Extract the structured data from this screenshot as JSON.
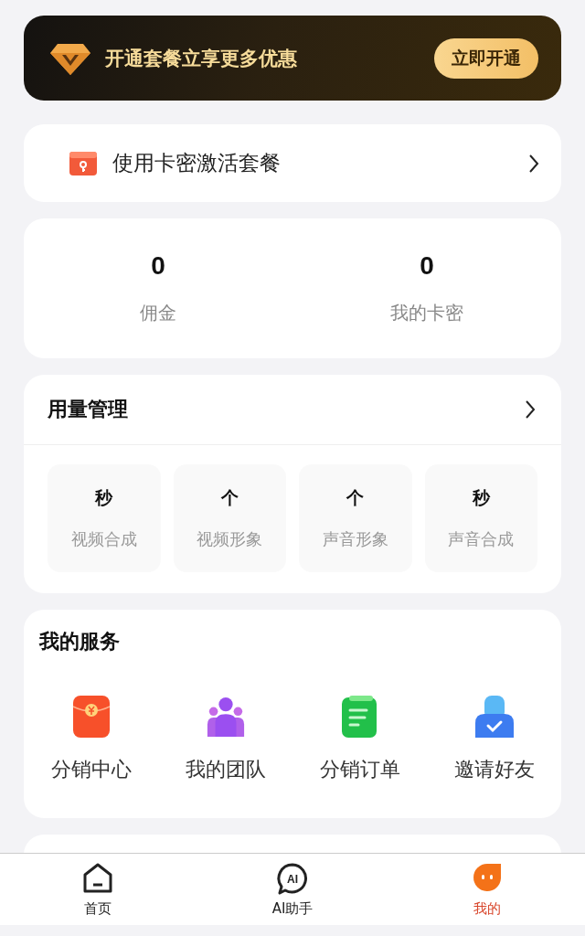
{
  "promo_banner": {
    "text": "开通套餐立享更多优惠",
    "button": "立即开通"
  },
  "activate_row": {
    "label": "使用卡密激活套餐"
  },
  "stats": [
    {
      "value": "0",
      "label": "佣金"
    },
    {
      "value": "0",
      "label": "我的卡密"
    }
  ],
  "usage": {
    "title": "用量管理",
    "items": [
      {
        "unit": "秒",
        "label": "视频合成"
      },
      {
        "unit": "个",
        "label": "视频形象"
      },
      {
        "unit": "个",
        "label": "声音形象"
      },
      {
        "unit": "秒",
        "label": "声音合成"
      }
    ]
  },
  "services": {
    "title": "我的服务",
    "items": [
      {
        "kind": "envelope",
        "label": "分销中心"
      },
      {
        "kind": "team",
        "label": "我的团队"
      },
      {
        "kind": "document",
        "label": "分销订单"
      },
      {
        "kind": "invite",
        "label": "邀请好友"
      }
    ]
  },
  "tab_bar": [
    {
      "kind": "home",
      "label": "首页",
      "selected": false
    },
    {
      "kind": "ai",
      "icon_text": "AI",
      "label": "AI助手",
      "selected": false
    },
    {
      "kind": "me",
      "label": "我的",
      "selected": true
    }
  ]
}
